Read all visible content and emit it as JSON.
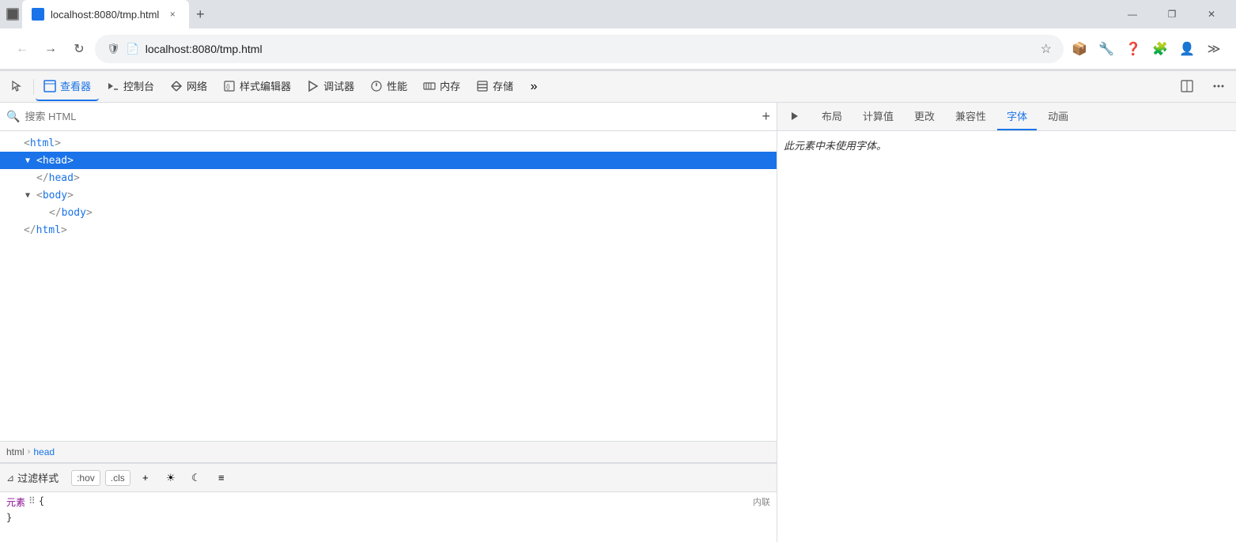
{
  "browser": {
    "tab_title": "localhost:8080/tmp.html",
    "tab_close": "×",
    "tab_new": "+",
    "url": "localhost:8080/tmp.html",
    "window_controls": [
      "—",
      "❐",
      "✕"
    ]
  },
  "devtools": {
    "tools": [
      {
        "id": "inspector-icon",
        "label": ""
      },
      {
        "id": "viewer",
        "label": "查看器",
        "active": true
      },
      {
        "id": "console",
        "label": "控制台"
      },
      {
        "id": "network",
        "label": "网络"
      },
      {
        "id": "style-editor",
        "label": "样式编辑器"
      },
      {
        "id": "debugger",
        "label": "调试器"
      },
      {
        "id": "performance",
        "label": "性能"
      },
      {
        "id": "memory",
        "label": "内存"
      },
      {
        "id": "storage",
        "label": "存储"
      }
    ],
    "search_placeholder": "搜索 HTML",
    "search_add": "+",
    "html_tree": [
      {
        "id": "html-open",
        "indent": 0,
        "toggle": "",
        "text": "<html>",
        "selected": false
      },
      {
        "id": "head-open",
        "indent": 1,
        "toggle": "▼",
        "text": "<head>",
        "selected": true
      },
      {
        "id": "head-close",
        "indent": 1,
        "toggle": "",
        "text": "</head>",
        "selected": false
      },
      {
        "id": "body-open",
        "indent": 1,
        "toggle": "▼",
        "text": "<body>",
        "selected": false
      },
      {
        "id": "body-close",
        "indent": 1,
        "toggle": "",
        "text": "</body>",
        "selected": false
      },
      {
        "id": "html-close",
        "indent": 0,
        "toggle": "",
        "text": "</html>",
        "selected": false
      }
    ],
    "breadcrumb": [
      {
        "label": "html",
        "active": false
      },
      {
        "sep": "›"
      },
      {
        "label": "head",
        "active": true
      }
    ],
    "styles_toolbar": {
      "filter_icon": "⊿",
      "filter_label": "过滤样式",
      "hov_btn": ":hov",
      "cls_btn": ".cls",
      "add_btn": "+",
      "light_btn": "☀",
      "dark_btn": "☾",
      "doc_btn": "≡"
    },
    "right_panel": {
      "tabs": [
        {
          "label": "▶",
          "icon": true,
          "active": false
        },
        {
          "label": "布局",
          "active": false
        },
        {
          "label": "计算值",
          "active": false
        },
        {
          "label": "更改",
          "active": false
        },
        {
          "label": "兼容性",
          "active": false
        },
        {
          "label": "字体",
          "active": true
        },
        {
          "label": "动画",
          "active": false
        }
      ],
      "font_content": "此元素中未使用字体。"
    },
    "styles_content": {
      "selector": "元素",
      "dots": "⠿",
      "brace_open": "{",
      "inline_label": "内联",
      "brace_close": "}",
      "property": ""
    }
  }
}
